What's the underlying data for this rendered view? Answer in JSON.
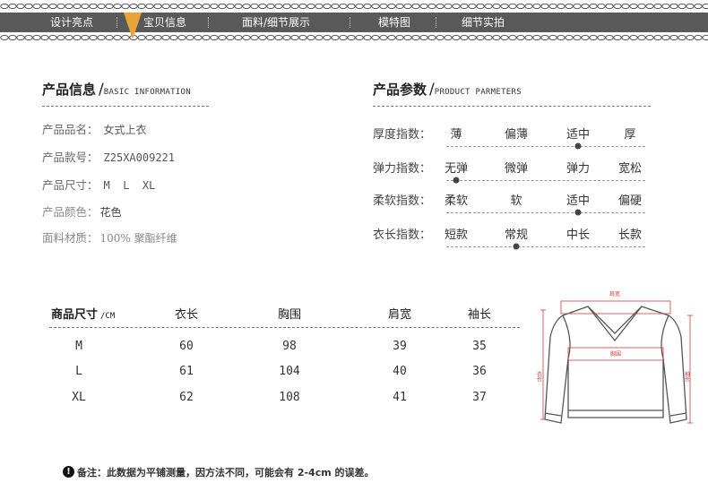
{
  "nav": {
    "items": [
      "设计亮点",
      "宝贝信息",
      "面料/细节展示",
      "模特图",
      "细节实拍"
    ],
    "active_color": "#e6a43a",
    "bar_color": "#595959"
  },
  "info": {
    "title": "产品信息",
    "title_en": "BASIC INFORMATION",
    "rows": [
      {
        "label": "产品品名：",
        "value": "女式上衣"
      },
      {
        "label": "产品款号：",
        "value": "Z25XA009221"
      },
      {
        "label": "产品尺寸：",
        "value": "M  L  XL"
      },
      {
        "label": "产品颜色：",
        "value": "花色"
      },
      {
        "label": "面料材质：",
        "value": "100% 聚酯纤维"
      }
    ]
  },
  "params": {
    "title": "产品参数",
    "title_en": "PRODUCT PARMETERS",
    "rows": [
      {
        "label": "厚度指数：",
        "options": [
          "薄",
          "偏薄",
          "适中",
          "厚"
        ],
        "selected": 2
      },
      {
        "label": "弹力指数：",
        "options": [
          "无弹",
          "微弹",
          "弹力",
          "宽松"
        ],
        "selected": 0
      },
      {
        "label": "柔软指数：",
        "options": [
          "柔软",
          "软",
          "适中",
          "偏硬"
        ],
        "selected": 2
      },
      {
        "label": "衣长指数：",
        "options": [
          "短款",
          "常规",
          "中长",
          "长款"
        ],
        "selected": 1
      }
    ]
  },
  "size_table": {
    "header_first": "商品尺寸",
    "unit": "/CM",
    "columns": [
      "衣长",
      "胸围",
      "肩宽",
      "袖长"
    ],
    "rows": [
      {
        "size": "M",
        "values": [
          "60",
          "98",
          "39",
          "35"
        ]
      },
      {
        "size": "L",
        "values": [
          "61",
          "104",
          "40",
          "36"
        ]
      },
      {
        "size": "XL",
        "values": [
          "62",
          "108",
          "41",
          "37"
        ]
      }
    ]
  },
  "diagram": {
    "shoulder_label": "肩宽",
    "chest_label": "胸围",
    "length_label": "衣长",
    "sleeve_label": "袖长",
    "measure_color": "#d23b3b"
  },
  "note": {
    "icon": "!",
    "text": "备注：此数据为平铺测量，因方法不同，可能会有 2-4cm 的误差。"
  }
}
